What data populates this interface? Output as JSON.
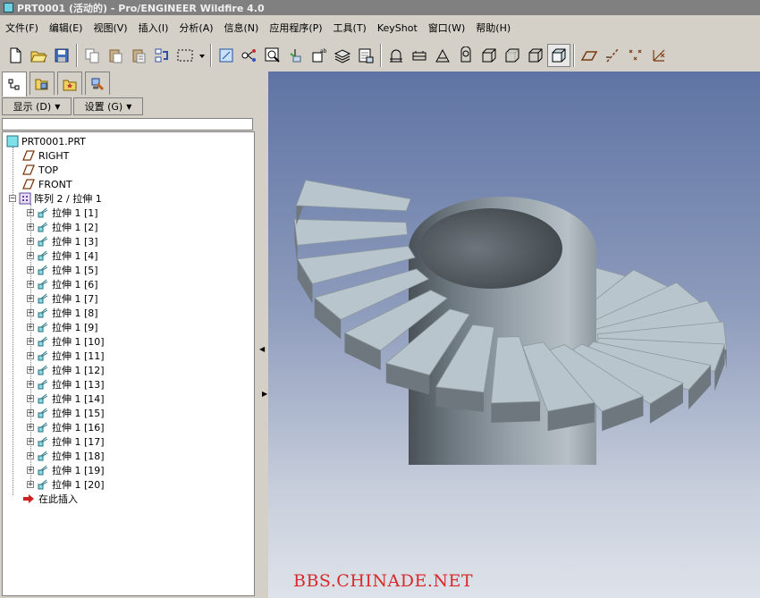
{
  "window": {
    "title": "PRT0001 (活动的) - Pro/ENGINEER Wildfire 4.0"
  },
  "menu": [
    "文件(F)",
    "编辑(E)",
    "视图(V)",
    "插入(I)",
    "分析(A)",
    "信息(N)",
    "应用程序(P)",
    "工具(T)",
    "KeyShot",
    "窗口(W)",
    "帮助(H)"
  ],
  "toolbar": {
    "groups": [
      [
        "new-icon",
        "open-icon",
        "save-icon"
      ],
      [
        "copy-icon",
        "paste-icon",
        "paste-special-icon",
        "regenerate-icon",
        "select-box-icon",
        "dropdown-arrow-icon"
      ],
      [
        "zoom-fit-icon",
        "datum-icon",
        "zoom-window-icon",
        "repaint-icon",
        "orient-icon",
        "layers-icon",
        "view-manager-icon"
      ],
      [
        "wireframe-icon",
        "hidden-line-icon",
        "no-hidden-icon",
        "shading-icon",
        "shaded-edges-icon",
        "shaded-icon",
        "shaded-model-icon",
        "shaded-active-icon"
      ],
      [
        "datum-planes-icon",
        "datum-axes-icon",
        "datum-points-icon",
        "coord-sys-icon"
      ]
    ]
  },
  "left_panel": {
    "tabs": [
      "model-tree-tab",
      "folder-browser-tab",
      "favorites-tab",
      "connections-tab"
    ],
    "show_button": "显示 (D)",
    "settings_button": "设置 (G)",
    "tree": {
      "root": "PRT0001.PRT",
      "datums": [
        "RIGHT",
        "TOP",
        "FRONT"
      ],
      "pattern": "阵列 2 / 拉伸 1",
      "features": [
        "拉伸 1 [1]",
        "拉伸 1 [2]",
        "拉伸 1 [3]",
        "拉伸 1 [4]",
        "拉伸 1 [5]",
        "拉伸 1 [6]",
        "拉伸 1 [7]",
        "拉伸 1 [8]",
        "拉伸 1 [9]",
        "拉伸 1 [10]",
        "拉伸 1 [11]",
        "拉伸 1 [12]",
        "拉伸 1 [13]",
        "拉伸 1 [14]",
        "拉伸 1 [15]",
        "拉伸 1 [16]",
        "拉伸 1 [17]",
        "拉伸 1 [18]",
        "拉伸 1 [19]",
        "拉伸 1 [20]"
      ],
      "insert_here": "在此插入"
    }
  },
  "viewport": {
    "watermark": "BBS.CHINADE.NET"
  }
}
